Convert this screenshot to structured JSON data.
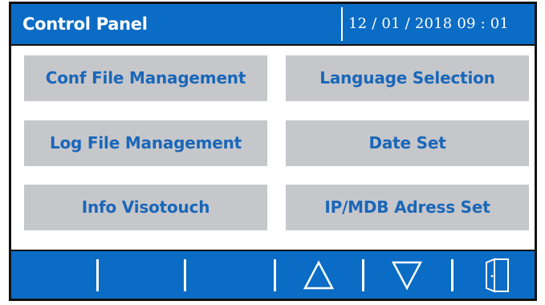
{
  "header": {
    "title": "Control Panel",
    "datetime": "12 / 01 / 2018   09 : 01"
  },
  "menu": {
    "conf_file_management": "Conf File Management",
    "language_selection": "Language Selection",
    "log_file_management": "Log File Management",
    "date_set": "Date Set",
    "info_visotouch": "Info Visotouch",
    "ip_mdb_address_set": "IP/MDB Adress Set"
  },
  "footer": {
    "icons": [
      "up-triangle-icon",
      "down-triangle-icon",
      "door-exit-icon"
    ]
  },
  "colors": {
    "bar_blue": "#0a6cc4",
    "button_grey": "#c5c7ca",
    "button_text_blue": "#1a67b9",
    "frame_black": "#111111"
  }
}
